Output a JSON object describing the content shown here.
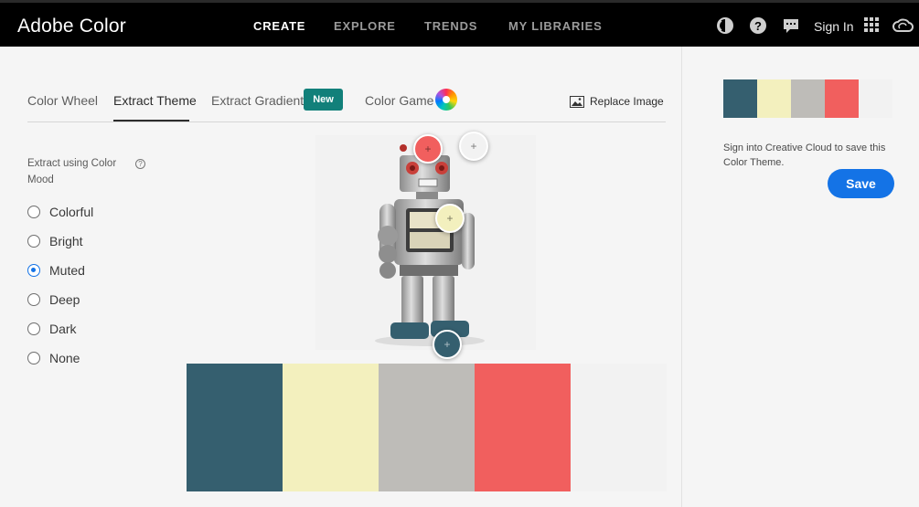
{
  "header": {
    "brand": "Adobe Color",
    "nav": [
      "CREATE",
      "EXPLORE",
      "TRENDS",
      "MY LIBRARIES"
    ],
    "active_nav": "CREATE",
    "sign_in": "Sign In",
    "icons": [
      "color-blind-icon",
      "help-icon",
      "chat-icon",
      "apps-grid-icon",
      "creative-cloud-icon"
    ]
  },
  "tabs": {
    "color_wheel": "Color Wheel",
    "extract_theme": "Extract Theme",
    "extract_gradient": "Extract Gradient",
    "new_badge": "New",
    "color_game": "Color Game",
    "active": "Extract Theme"
  },
  "replace_image": "Replace Image",
  "mood": {
    "label": "Extract using Color Mood",
    "help": "?",
    "options": [
      "Colorful",
      "Bright",
      "Muted",
      "Deep",
      "Dark",
      "None"
    ],
    "selected": "Muted"
  },
  "theme_colors": [
    "#355F6F",
    "#F3F0BE",
    "#BEBCB8",
    "#F15F5E",
    "#F2F2F2"
  ],
  "image_handles": [
    {
      "color": "#F15F5E",
      "label": "+"
    },
    {
      "color": "#F2F2F2",
      "label": "+"
    },
    {
      "color": "#F3F0BE",
      "label": "+"
    },
    {
      "color": "#355F6F",
      "label": "+"
    }
  ],
  "side": {
    "message": "Sign into Creative Cloud to save this Color Theme.",
    "save": "Save"
  }
}
